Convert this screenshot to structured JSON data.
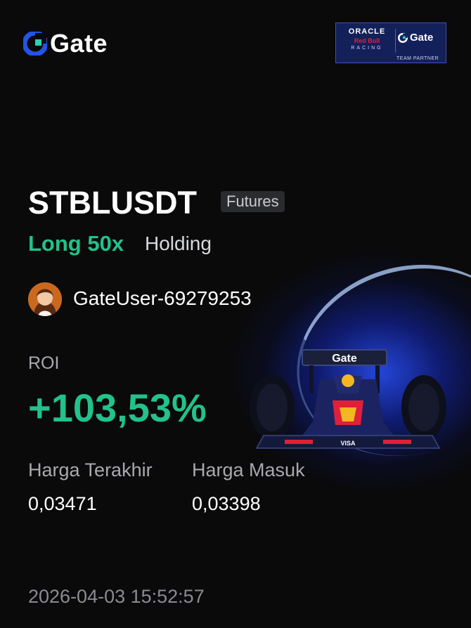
{
  "brand": {
    "name": "Gate",
    "logo_icon": "gate-logo-icon"
  },
  "partner_badge": {
    "oracle": "ORACLE",
    "redbull": "Red Bull",
    "racing": "RACING",
    "gate": "Gate",
    "tagline": "TEAM PARTNER"
  },
  "position": {
    "pair": "STBLUSDT",
    "type": "Futures",
    "side": "Long 50x",
    "status": "Holding"
  },
  "user": {
    "name": "GateUser-69279253",
    "avatar_icon": "user-avatar"
  },
  "roi": {
    "label": "ROI",
    "value": "+103,53%"
  },
  "prices": {
    "last_label": "Harga Terakhir",
    "last_value": "0,03471",
    "entry_label": "Harga Masuk",
    "entry_value": "0,03398"
  },
  "timestamp": "2026-04-03 15:52:57",
  "colors": {
    "accent_green": "#22c28a",
    "brand_blue": "#2354e6",
    "background": "#0a0a0b"
  }
}
